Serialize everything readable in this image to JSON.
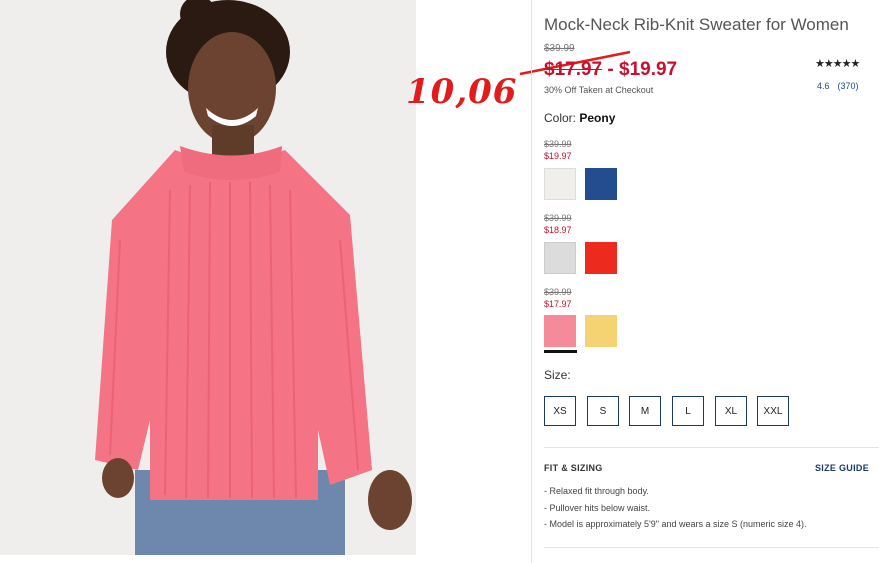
{
  "product": {
    "title": "Mock-Neck Rib-Knit Sweater for Women",
    "original_price": "$39.99",
    "sale_low": "$17.97",
    "sale_sep": " - ",
    "sale_high": "$19.97",
    "promo": "30% Off Taken at Checkout",
    "stars": "★★★★★",
    "rating": "4.6",
    "review_count": "(370)"
  },
  "annotation": {
    "text": "10,06",
    "color": "#e21b1b"
  },
  "color": {
    "label": "Color:",
    "selected": "Peony"
  },
  "color_groups": [
    {
      "original": "$39.99",
      "sale": "$19.97",
      "swatches": [
        "white",
        "navy"
      ]
    },
    {
      "original": "$39.99",
      "sale": "$18.97",
      "swatches": [
        "light-heather-gray",
        "red"
      ]
    },
    {
      "original": "$39.99",
      "sale": "$17.97",
      "swatches": [
        "peony-pink",
        "yellow"
      ]
    }
  ],
  "size": {
    "label": "Size:",
    "options": [
      "XS",
      "S",
      "M",
      "L",
      "XL",
      "XXL"
    ]
  },
  "fit": {
    "title": "FIT & SIZING",
    "guide_link": "SIZE GUIDE",
    "items": [
      "Relaxed fit through body.",
      "Pullover hits below waist.",
      "Model is approximately 5'9\" and wears a size S (numeric size 4)."
    ]
  },
  "colors": {
    "sale_red": "#c8102e",
    "navy": "#1b3a66",
    "swatch_peony": "#f48a9a"
  }
}
